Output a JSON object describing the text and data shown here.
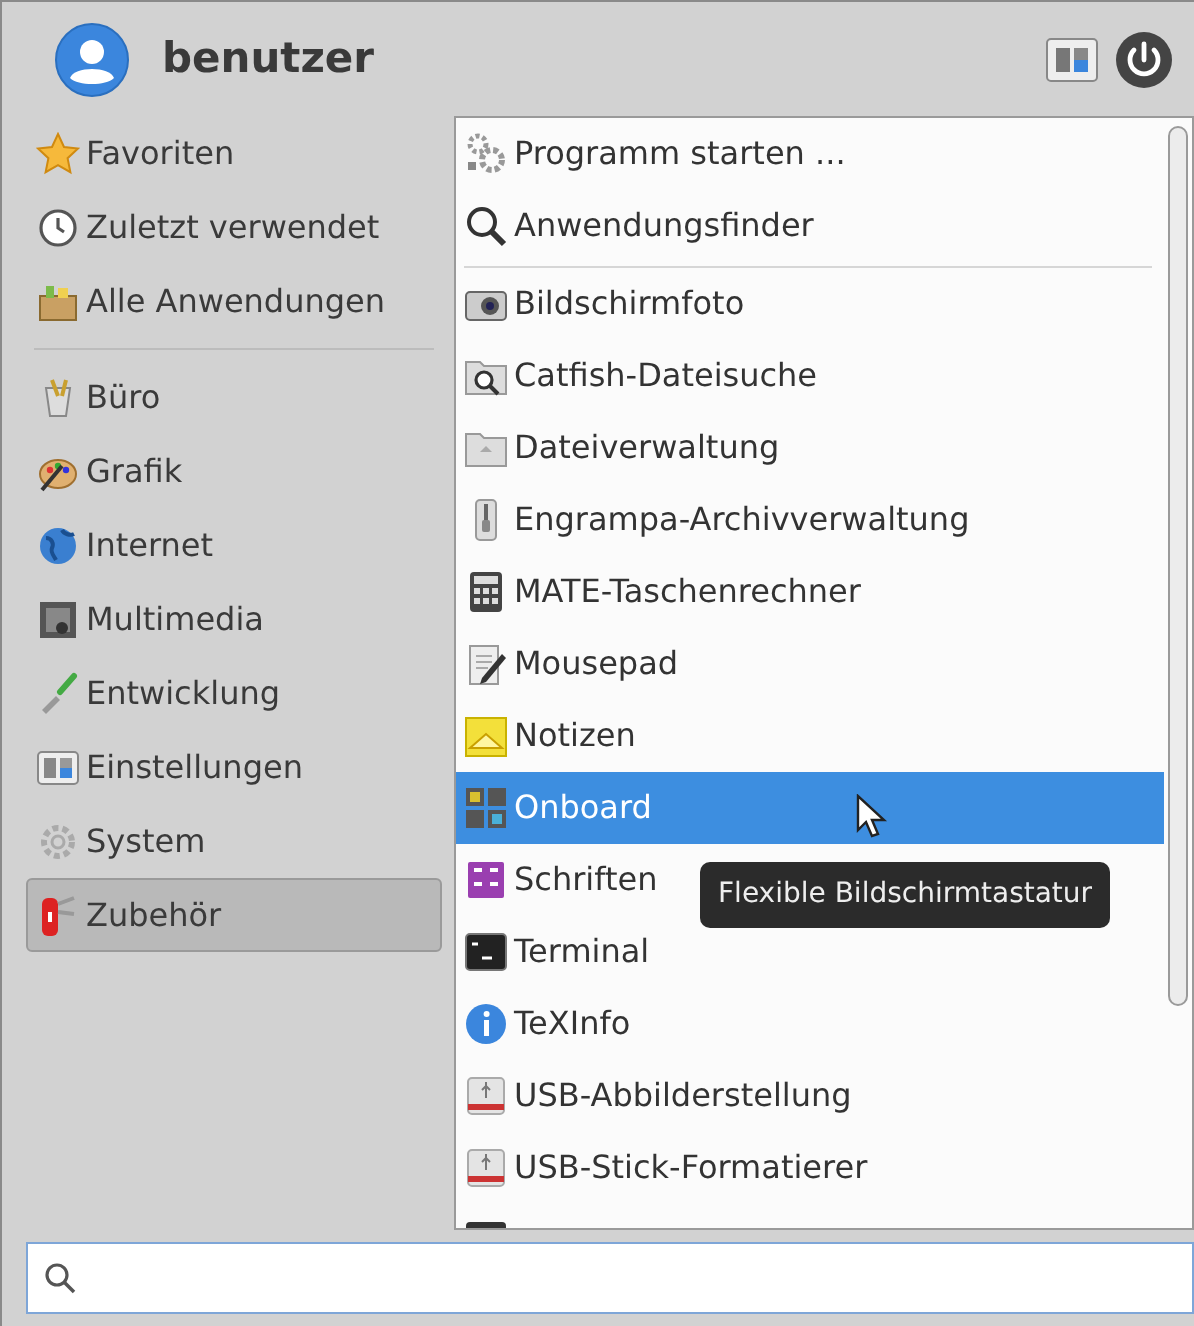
{
  "user": {
    "name": "benutzer"
  },
  "category_groups": [
    {
      "items": [
        {
          "label": "Favoriten",
          "selected": false
        },
        {
          "label": "Zuletzt verwendet",
          "selected": false
        },
        {
          "label": "Alle Anwendungen",
          "selected": false
        }
      ]
    },
    {
      "items": [
        {
          "label": "Büro",
          "selected": false
        },
        {
          "label": "Grafik",
          "selected": false
        },
        {
          "label": "Internet",
          "selected": false
        },
        {
          "label": "Multimedia",
          "selected": false
        },
        {
          "label": "Entwicklung",
          "selected": false
        },
        {
          "label": "Einstellungen",
          "selected": false
        },
        {
          "label": "System",
          "selected": false
        },
        {
          "label": "Zubehör",
          "selected": true
        }
      ]
    }
  ],
  "app_groups": [
    {
      "items": [
        {
          "label": "Programm starten ...",
          "selected": false
        },
        {
          "label": "Anwendungsfinder",
          "selected": false
        }
      ]
    },
    {
      "items": [
        {
          "label": "Bildschirmfoto",
          "selected": false
        },
        {
          "label": "Catfish-Dateisuche",
          "selected": false
        },
        {
          "label": "Dateiverwaltung",
          "selected": false
        },
        {
          "label": "Engrampa-Archivverwaltung",
          "selected": false
        },
        {
          "label": "MATE-Taschenrechner",
          "selected": false
        },
        {
          "label": "Mousepad",
          "selected": false
        },
        {
          "label": "Notizen",
          "selected": false
        },
        {
          "label": "Onboard",
          "selected": true
        },
        {
          "label": "Schriften",
          "selected": false
        },
        {
          "label": "Terminal",
          "selected": false
        },
        {
          "label": "TeXInfo",
          "selected": false
        },
        {
          "label": "USB-Abbilderstellung",
          "selected": false
        },
        {
          "label": "USB-Stick-Formatierer",
          "selected": false
        }
      ]
    }
  ],
  "tooltip": {
    "text": "Flexible Bildschirmtastatur"
  }
}
